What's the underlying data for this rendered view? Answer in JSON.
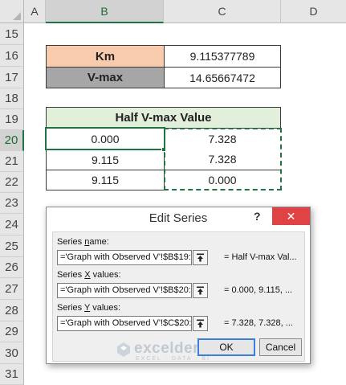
{
  "sheet": {
    "columns": [
      "A",
      "B",
      "C",
      "D"
    ],
    "rows": [
      "15",
      "16",
      "17",
      "18",
      "19",
      "20",
      "21",
      "22",
      "23",
      "24",
      "25",
      "26",
      "27",
      "28",
      "29",
      "30",
      "31"
    ],
    "km_label": "Km",
    "km_value": "9.115377789",
    "vmax_label": "V-max",
    "vmax_value": "14.65667472",
    "table_header": "Half V-max Value",
    "table_rows": [
      {
        "b": "0.000",
        "c": "7.328"
      },
      {
        "b": "9.115",
        "c": "7.328"
      },
      {
        "b": "9.115",
        "c": "0.000"
      }
    ]
  },
  "dialog": {
    "title": "Edit Series",
    "help": "?",
    "close": "✕",
    "series_name_label_pre": "Series ",
    "series_name_label_u": "n",
    "series_name_label_post": "ame:",
    "series_name_ref": "='Graph with Observed V'!$B$19:",
    "series_name_result": "= Half V-max Val...",
    "series_x_label_pre": "Series ",
    "series_x_label_u": "X",
    "series_x_label_post": " values:",
    "series_x_ref": "='Graph with Observed V'!$B$20:",
    "series_x_result": "= 0.000, 9.115, ...",
    "series_y_label_pre": "Series ",
    "series_y_label_u": "Y",
    "series_y_label_post": " values:",
    "series_y_ref": "='Graph with Observed V'!$C$20:",
    "series_y_result": "= 7.328, 7.328, ...",
    "ok_label": "OK",
    "cancel_label": "Cancel"
  },
  "watermark": {
    "name": "exceldemy",
    "tagline": "EXCEL · DATA · BI"
  },
  "colors": {
    "km_fill": "#f8cbad",
    "vmax_fill": "#a6a6a6",
    "header_fill": "#e2efda",
    "selection": "#217346",
    "marching_ants": "#217346",
    "close_button": "#e04343"
  },
  "icons": {
    "collapse_dialog": "collapse-dialog-icon",
    "close": "close-icon",
    "corner": "select-all-icon",
    "watermark": "exceldemy-logo-icon"
  }
}
